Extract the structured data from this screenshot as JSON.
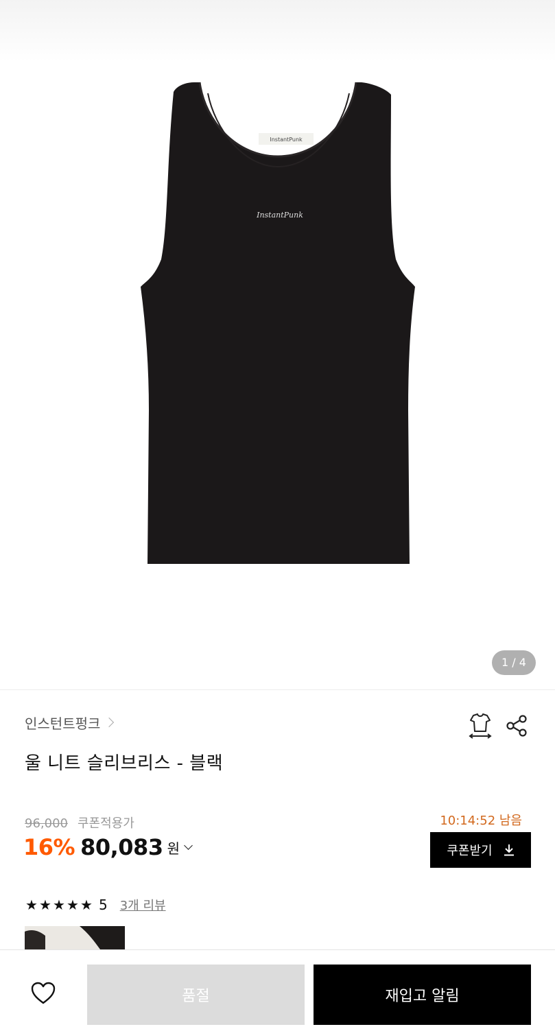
{
  "gallery": {
    "page_indicator": "1 / 4",
    "image_label": "InstantPunk",
    "tag_label": "InstantPunk"
  },
  "product": {
    "brand": "인스턴트펑크",
    "title": "울 니트 슬리브리스 - 블랙"
  },
  "price": {
    "original": "96,000",
    "coupon_label": "쿠폰적용가",
    "discount_rate": "16%",
    "sale_price": "80,083",
    "currency": "원",
    "countdown": "10:14:52 남음",
    "coupon_button": "쿠폰받기"
  },
  "rating": {
    "stars": [
      "★",
      "★",
      "★",
      "★",
      "★"
    ],
    "score": 5,
    "value": "5",
    "review_link": "3개 리뷰"
  },
  "bottom_bar": {
    "soldout_label": "품절",
    "restock_label": "재입고 알림"
  },
  "colors": {
    "accent_discount": "#ff5a00",
    "countdown": "#d2691e",
    "primary_button": "#000000",
    "disabled_button": "#dcdcdc"
  },
  "icons": [
    "fit-guide-icon",
    "share-icon",
    "chevron-right-icon",
    "chevron-down-icon",
    "download-icon",
    "heart-icon",
    "star-icon"
  ]
}
